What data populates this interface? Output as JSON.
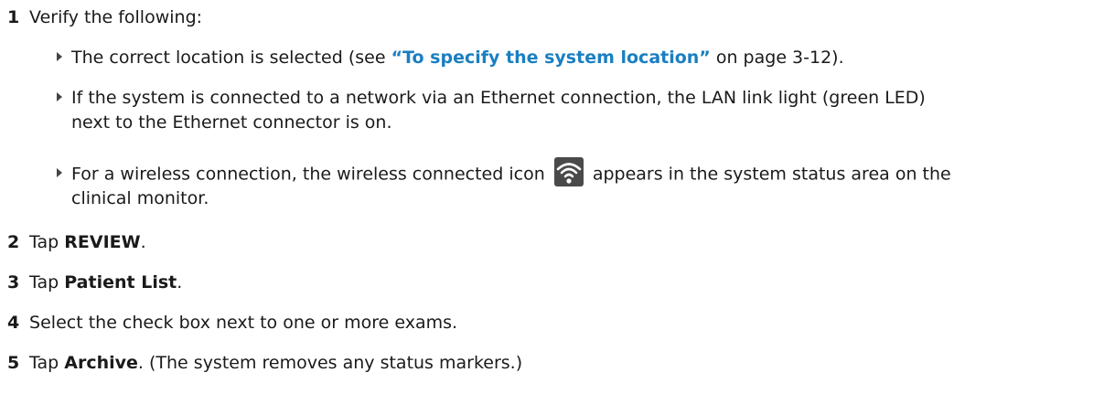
{
  "steps": [
    {
      "num": "1",
      "text": "Verify the following:"
    },
    {
      "num": "2",
      "pre": "Tap ",
      "bold": "REVIEW",
      "post": "."
    },
    {
      "num": "3",
      "pre": "Tap ",
      "bold": "Patient List",
      "post": "."
    },
    {
      "num": "4",
      "text": "Select the check box next to one or more exams."
    },
    {
      "num": "5",
      "pre": "Tap ",
      "bold": "Archive",
      "post": ". (The system removes any status markers.)"
    }
  ],
  "bullets": [
    {
      "pre": "The correct location is selected (see ",
      "link": "“To specify the system location”",
      "post": " on page 3-12)."
    },
    {
      "line1": "If the system is connected to a network via an Ethernet connection, the LAN link light (green LED)",
      "line2": "next to the Ethernet connector is on."
    },
    {
      "pre": "For a wireless connection, the wireless connected icon",
      "post": "appears in the system status area on the",
      "line2": "clinical monitor."
    }
  ],
  "icons": {
    "bullet": "triangle-bullet-icon",
    "wireless": "wireless-connected-icon"
  },
  "colors": {
    "link": "#1a7fc1",
    "text": "#1a1a1a"
  }
}
